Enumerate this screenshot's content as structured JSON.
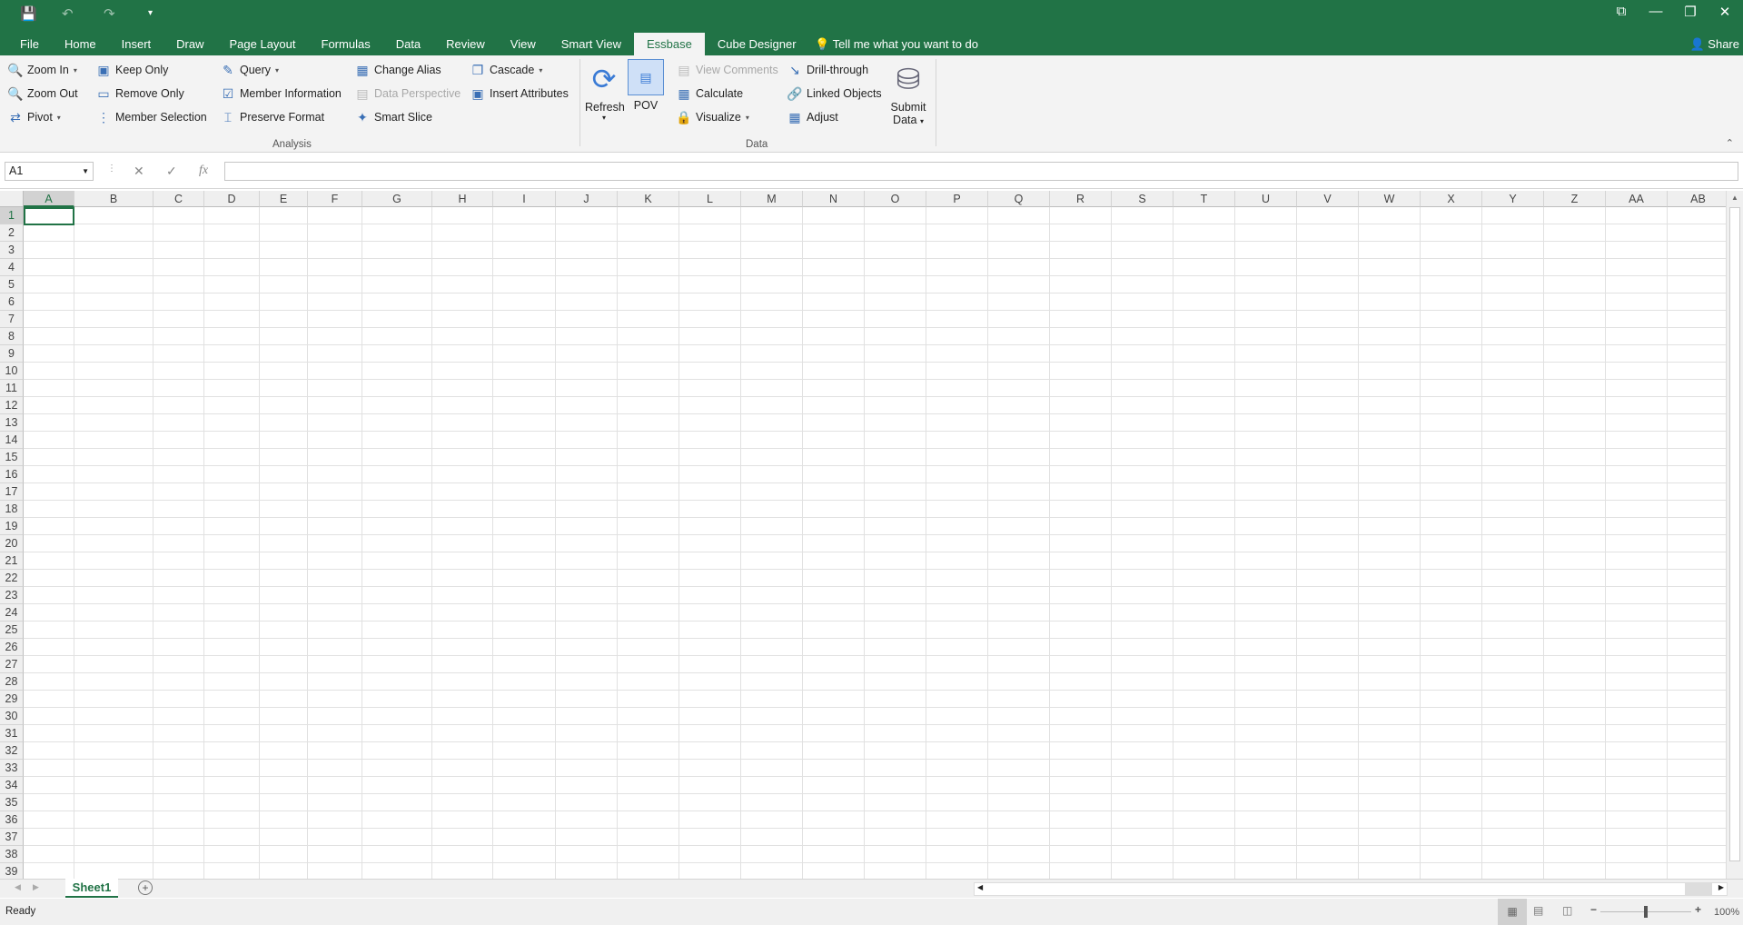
{
  "quick_access": {
    "save": "💾",
    "undo": "↶",
    "redo": "↷",
    "customize": "▾"
  },
  "window": {
    "ribbon_options": "⧉",
    "minimize": "—",
    "restore": "❐",
    "close": "✕"
  },
  "tabs": [
    "File",
    "Home",
    "Insert",
    "Draw",
    "Page Layout",
    "Formulas",
    "Data",
    "Review",
    "View",
    "Smart View",
    "Essbase",
    "Cube Designer"
  ],
  "active_tab": "Essbase",
  "tell_me": "Tell me what you want to do",
  "share": "Share",
  "ribbon": {
    "analysis": {
      "label": "Analysis",
      "items": [
        "Zoom In",
        "Zoom Out",
        "Pivot",
        "Keep Only",
        "Remove Only",
        "Member Selection",
        "Query",
        "Member Information",
        "Preserve Format",
        "Change Alias",
        "Data Perspective",
        "Smart Slice",
        "Cascade",
        "Insert Attributes"
      ]
    },
    "data": {
      "label": "Data",
      "refresh": "Refresh",
      "pov": "POV",
      "items": [
        "View Comments",
        "Calculate",
        "Visualize",
        "Drill-through",
        "Linked Objects",
        "Adjust"
      ],
      "submit": "Submit",
      "submit2": "Data"
    }
  },
  "formula_bar": {
    "name_box": "A1",
    "fx": "fx",
    "cancel": "✕",
    "enter": "✓",
    "value": ""
  },
  "columns": [
    "A",
    "B",
    "C",
    "D",
    "E",
    "F",
    "G",
    "H",
    "I",
    "J",
    "K",
    "L",
    "M",
    "N",
    "O",
    "P",
    "Q",
    "R",
    "S",
    "T",
    "U",
    "V",
    "W",
    "X",
    "Y",
    "Z",
    "AA",
    "AB"
  ],
  "row_count": 39,
  "selected_cell": "A1",
  "sheets": [
    "Sheet1"
  ],
  "status": {
    "text": "Ready",
    "zoom": "100%",
    "zoom_fraction": 0.5
  },
  "colors": {
    "accent": "#217346"
  }
}
